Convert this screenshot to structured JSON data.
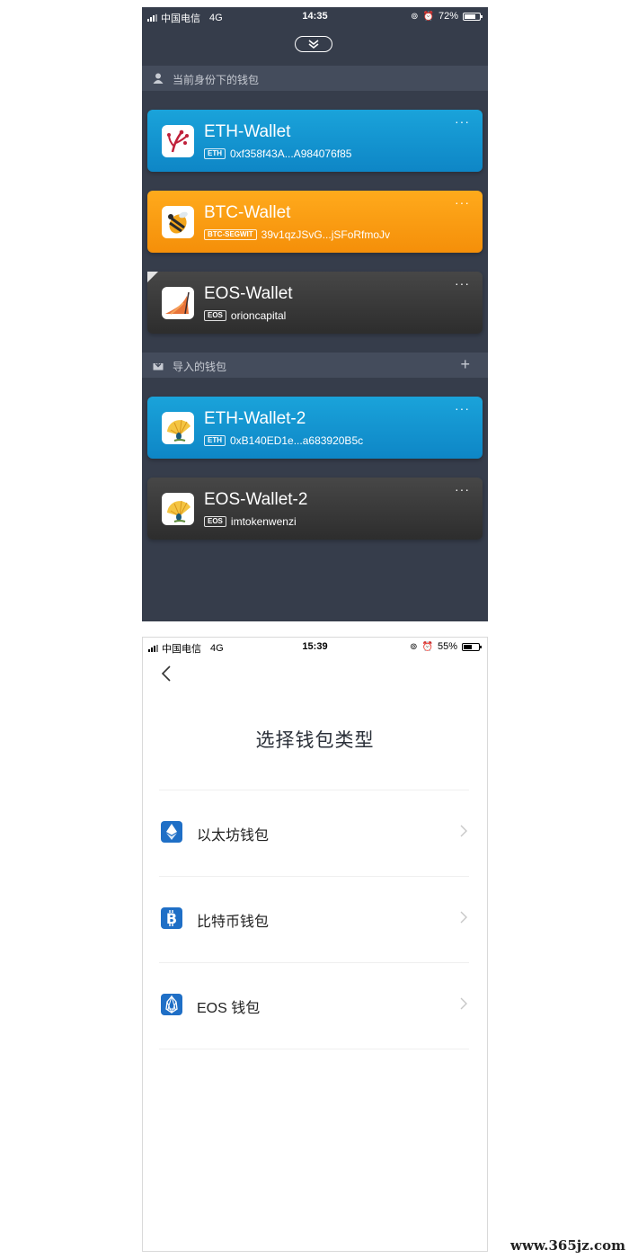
{
  "screen1": {
    "status_bar": {
      "carrier": "中国电信",
      "network": "4G",
      "time": "14:35",
      "battery": "72%",
      "battery_level": 0.72
    },
    "section_identity": {
      "label": "当前身份下的钱包"
    },
    "section_imported": {
      "label": "导入的钱包",
      "add_label": "+"
    },
    "more_label": "···",
    "wallets": [
      {
        "name": "ETH-Wallet",
        "chain": "ETH",
        "address": "0xf358f43A...A984076f85",
        "color": "#1aa3da"
      },
      {
        "name": "BTC-Wallet",
        "chain": "BTC-SEGWIT",
        "address": "39v1qzJSvG...jSFoRfmoJv",
        "color": "#f8a014"
      },
      {
        "name": "EOS-Wallet",
        "chain": "EOS",
        "address": "orioncapital",
        "color": "#3a3a3a"
      },
      {
        "name": "ETH-Wallet-2",
        "chain": "ETH",
        "address": "0xB140ED1e...a683920B5c",
        "color": "#1aa3da"
      },
      {
        "name": "EOS-Wallet-2",
        "chain": "EOS",
        "address": "imtokenwenzi",
        "color": "#3a3a3a"
      }
    ]
  },
  "screen2": {
    "status_bar": {
      "carrier": "中国电信",
      "network": "4G",
      "time": "15:39",
      "battery": "55%",
      "battery_level": 0.55
    },
    "title": "选择钱包类型",
    "options": [
      {
        "label": "以太坊钱包",
        "icon": "ethereum-icon"
      },
      {
        "label": "比特币钱包",
        "icon": "bitcoin-icon"
      },
      {
        "label": "EOS 钱包",
        "icon": "eos-icon"
      }
    ]
  },
  "watermark": "www.365jz.com"
}
